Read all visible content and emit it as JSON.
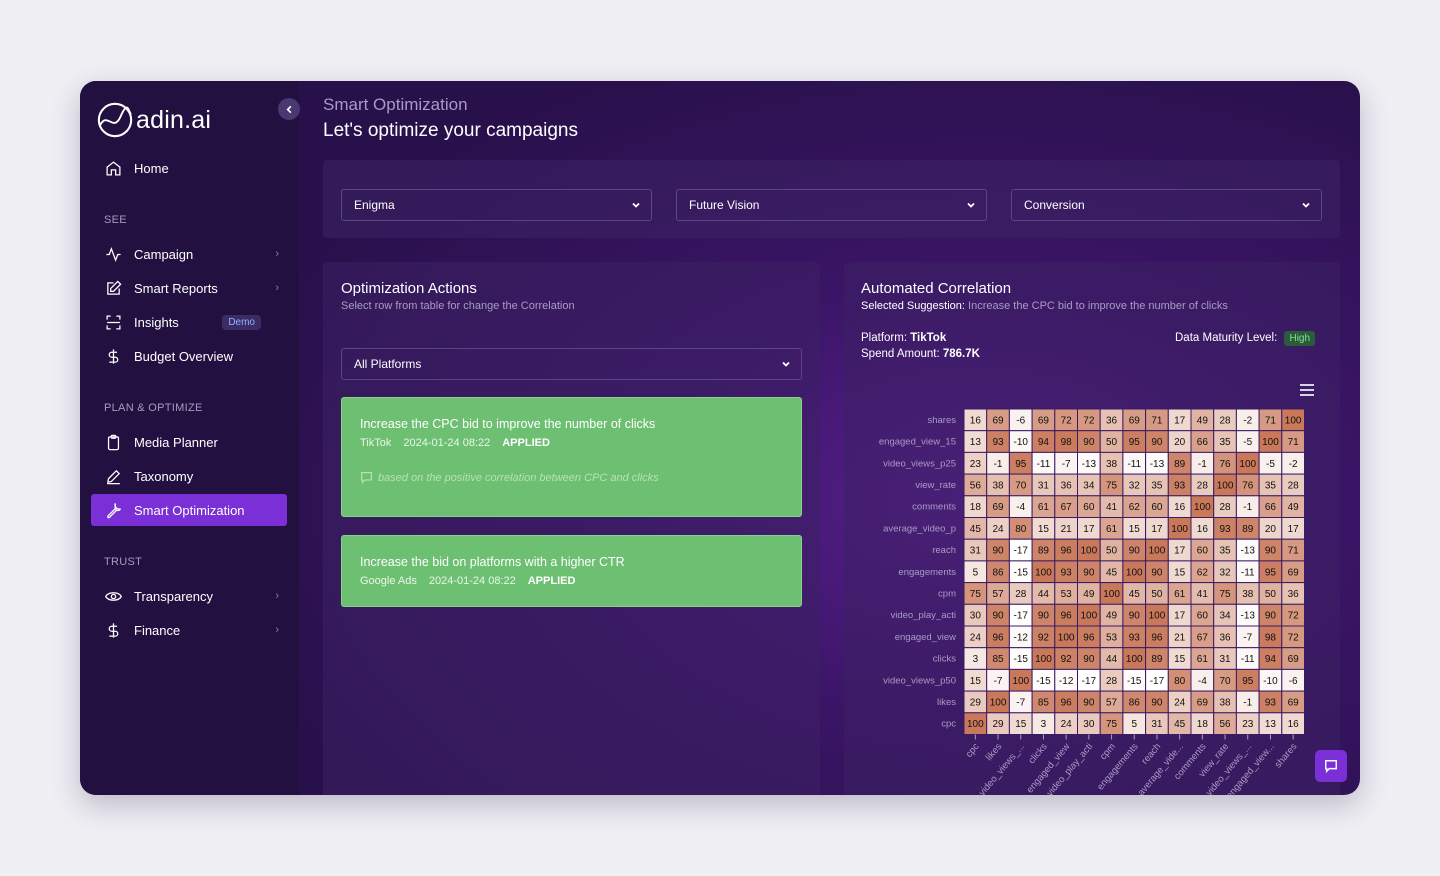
{
  "brand": {
    "name": "adin.ai"
  },
  "sidebar": {
    "items": [
      {
        "label": "Home",
        "icon": "home-icon"
      },
      {
        "label": "Campaign",
        "icon": "activity-icon"
      },
      {
        "label": "Smart Reports",
        "icon": "edit-report-icon"
      },
      {
        "label": "Insights",
        "icon": "scan-icon",
        "badge": "Demo"
      },
      {
        "label": "Budget Overview",
        "icon": "dollar-icon"
      },
      {
        "label": "Media Planner",
        "icon": "clipboard-icon"
      },
      {
        "label": "Taxonomy",
        "icon": "pen-icon"
      },
      {
        "label": "Smart Optimization",
        "icon": "wrench-icon"
      },
      {
        "label": "Transparency",
        "icon": "eye-icon"
      },
      {
        "label": "Finance",
        "icon": "dollar-icon"
      }
    ],
    "sections": {
      "see": "SEE",
      "plan": "PLAN & OPTIMIZE",
      "trust": "TRUST"
    }
  },
  "header": {
    "breadcrumb": "Smart Optimization",
    "title": "Let's optimize your campaigns"
  },
  "filters": {
    "advertiser": "Enigma",
    "campaign": "Future Vision",
    "objective": "Conversion"
  },
  "actions_panel": {
    "title": "Optimization Actions",
    "subtitle": "Select row from table for change the Correlation",
    "platform_filter": "All Platforms",
    "cards": [
      {
        "title": "Increase the CPC bid to improve the number of clicks",
        "platform": "TikTok",
        "date": "2024-01-24 08:22",
        "status": "APPLIED",
        "note": "based on the positive correlation between CPC and clicks"
      },
      {
        "title": "Increase the bid on platforms with a higher CTR",
        "platform": "Google Ads",
        "date": "2024-01-24 08:22",
        "status": "APPLIED"
      }
    ]
  },
  "correlation_panel": {
    "title": "Automated Correlation",
    "selected_label": "Selected Suggestion:",
    "selected_value": "Increase the CPC bid to improve the number of clicks",
    "platform_label": "Platform:",
    "platform_value": "TikTok",
    "spend_label": "Spend Amount:",
    "spend_value": "786.7K",
    "maturity_label": "Data Maturity Level:",
    "maturity_value": "High"
  },
  "colors": {
    "accent": "#7b2fd6",
    "card_green": "#6dbf72",
    "heat_low": "#ffffff",
    "heat_high": "#c9785a"
  },
  "chart_data": {
    "type": "heatmap",
    "rows": [
      "shares",
      "engaged_view_15",
      "video_views_p25",
      "view_rate",
      "comments",
      "average_video_p",
      "reach",
      "engagements",
      "cpm",
      "video_play_acti",
      "engaged_view",
      "clicks",
      "video_views_p50",
      "likes",
      "cpc"
    ],
    "columns": [
      "cpc",
      "likes",
      "video_views_...",
      "clicks",
      "engaged_view",
      "video_play_acti",
      "cpm",
      "engagements",
      "reach",
      "average_vide...",
      "comments",
      "view_rate",
      "video_views_...",
      "engaged_view...",
      "shares"
    ],
    "values": [
      [
        16,
        69,
        -6,
        69,
        72,
        72,
        36,
        69,
        71,
        17,
        49,
        28,
        -2,
        71,
        100
      ],
      [
        13,
        93,
        -10,
        94,
        98,
        90,
        50,
        95,
        90,
        20,
        66,
        35,
        -5,
        100,
        71
      ],
      [
        23,
        -1,
        95,
        -11,
        -7,
        -13,
        38,
        -11,
        -13,
        89,
        -1,
        76,
        100,
        -5,
        -2
      ],
      [
        56,
        38,
        70,
        31,
        36,
        34,
        75,
        32,
        35,
        93,
        28,
        100,
        76,
        35,
        28
      ],
      [
        18,
        69,
        -4,
        61,
        67,
        60,
        41,
        62,
        60,
        16,
        100,
        28,
        -1,
        66,
        49
      ],
      [
        45,
        24,
        80,
        15,
        21,
        17,
        61,
        15,
        17,
        100,
        16,
        93,
        89,
        20,
        17
      ],
      [
        31,
        90,
        -17,
        89,
        96,
        100,
        50,
        90,
        100,
        17,
        60,
        35,
        -13,
        90,
        71
      ],
      [
        5,
        86,
        -15,
        100,
        93,
        90,
        45,
        100,
        90,
        15,
        62,
        32,
        -11,
        95,
        69
      ],
      [
        75,
        57,
        28,
        44,
        53,
        49,
        100,
        45,
        50,
        61,
        41,
        75,
        38,
        50,
        36
      ],
      [
        30,
        90,
        -17,
        90,
        96,
        100,
        49,
        90,
        100,
        17,
        60,
        34,
        -13,
        90,
        72
      ],
      [
        24,
        96,
        -12,
        92,
        100,
        96,
        53,
        93,
        96,
        21,
        67,
        36,
        -7,
        98,
        72
      ],
      [
        3,
        85,
        -15,
        100,
        92,
        90,
        44,
        100,
        89,
        15,
        61,
        31,
        -11,
        94,
        69
      ],
      [
        15,
        -7,
        100,
        -15,
        -12,
        -17,
        28,
        -15,
        -17,
        80,
        -4,
        70,
        95,
        -10,
        -6
      ],
      [
        29,
        100,
        -7,
        85,
        96,
        90,
        57,
        86,
        90,
        24,
        69,
        38,
        -1,
        93,
        69
      ],
      [
        100,
        29,
        15,
        3,
        24,
        30,
        75,
        5,
        31,
        45,
        18,
        56,
        23,
        13,
        16
      ]
    ],
    "vmin": -17,
    "vmax": 100
  }
}
